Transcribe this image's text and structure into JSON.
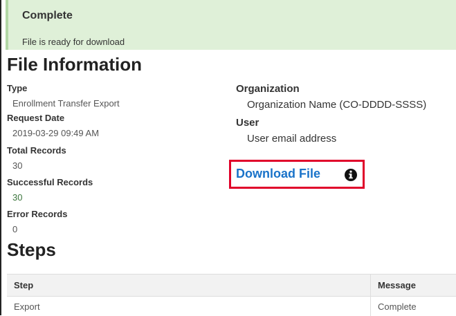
{
  "alert": {
    "title": "Complete",
    "message": "File is ready for download"
  },
  "file_info": {
    "heading": "File Information",
    "fields": [
      {
        "label": "Type",
        "value": "Enrollment Transfer Export"
      },
      {
        "label": "Request Date",
        "value": "2019-03-29 09:49 AM"
      },
      {
        "label": "Total Records",
        "value": "30"
      },
      {
        "label": "Successful Records",
        "value": "30"
      },
      {
        "label": "Error Records",
        "value": "0"
      }
    ],
    "right_fields": [
      {
        "label": "Organization",
        "value": "Organization Name (CO-DDDD-SSSS)"
      },
      {
        "label": "User",
        "value": "User email address"
      }
    ],
    "download_label": "Download File",
    "download_icon": "info-circle-icon",
    "highlight_color": "#e0002a",
    "link_color": "#1a73c9"
  },
  "steps": {
    "heading": "Steps",
    "columns": [
      "Step",
      "Message"
    ],
    "rows": [
      [
        "Export",
        "Complete"
      ]
    ]
  },
  "colors": {
    "alert_bg": "#dff0d8",
    "success_text": "#3c763d"
  }
}
